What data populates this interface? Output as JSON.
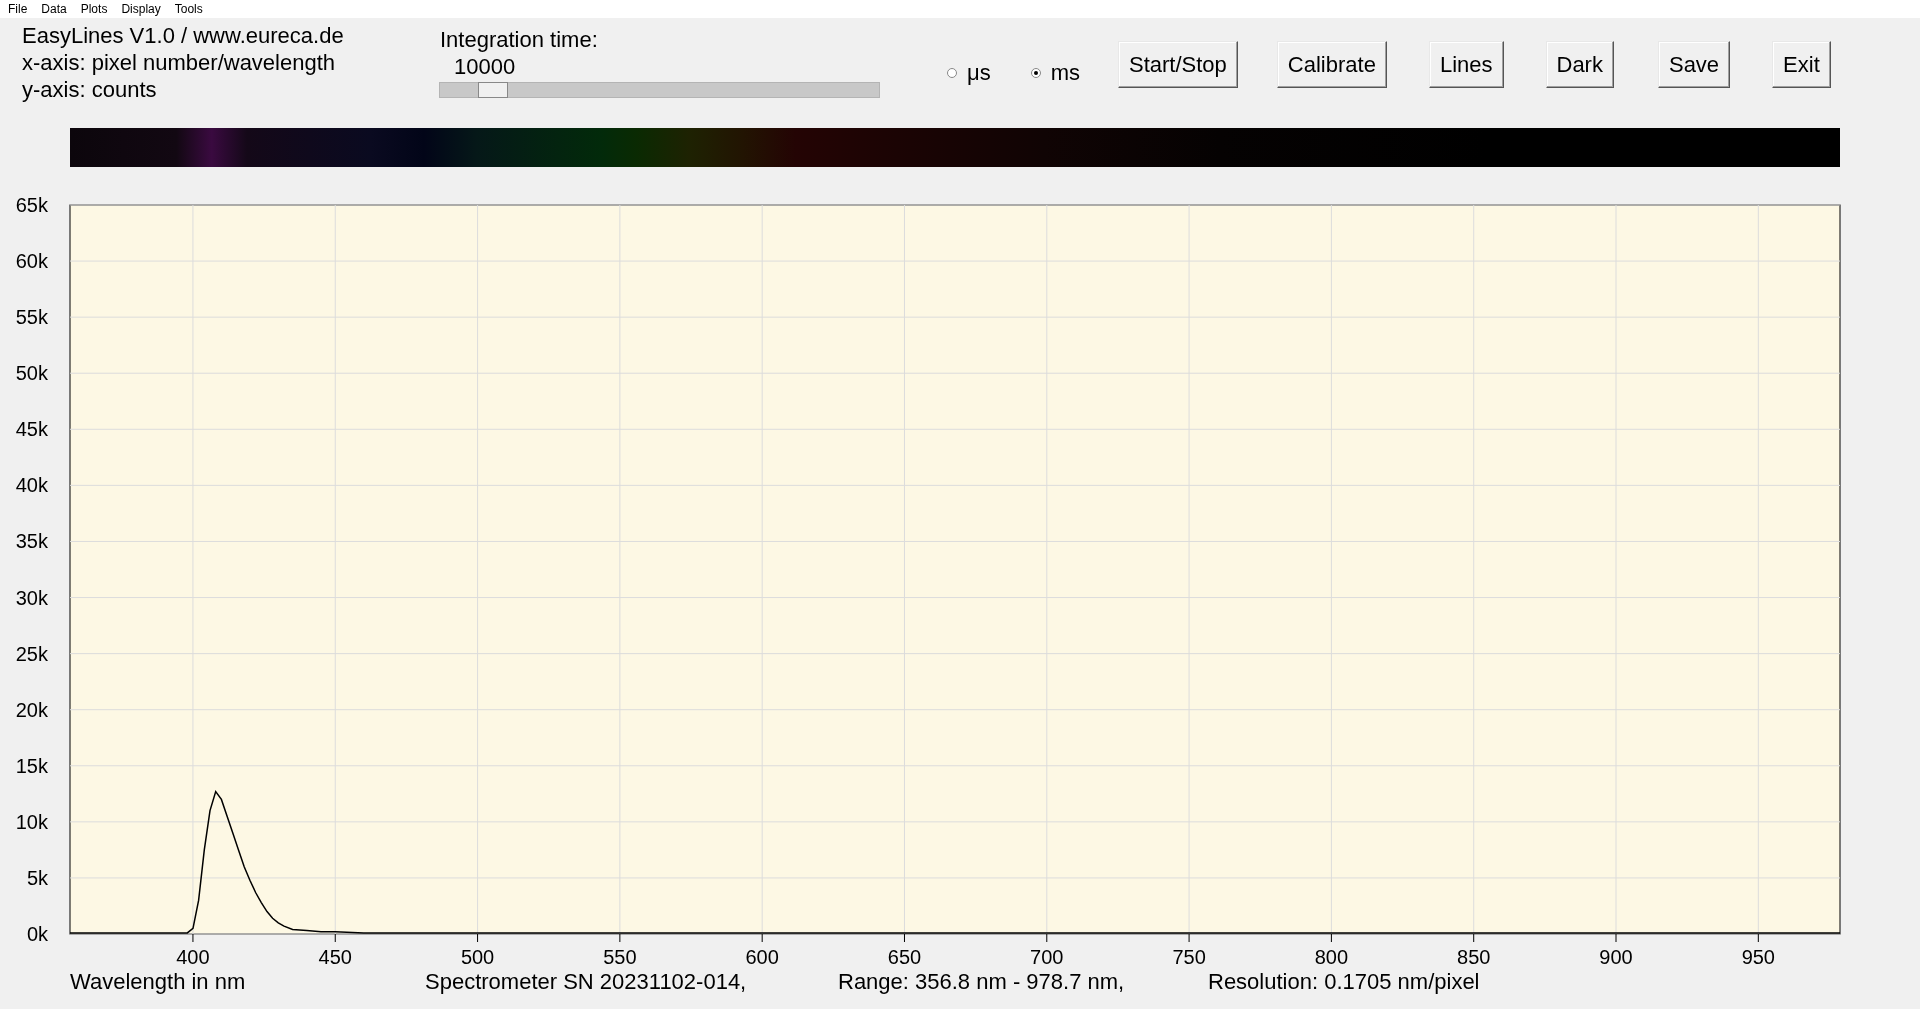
{
  "menu": [
    "File",
    "Data",
    "Plots",
    "Display",
    "Tools"
  ],
  "header": {
    "lines": [
      "EasyLines V1.0 / www.eureca.de",
      "x-axis: pixel number/wavelength",
      "y-axis: counts"
    ]
  },
  "integration": {
    "label": "Integration time:",
    "value": "10000",
    "level": 0.12
  },
  "units": [
    {
      "label": "μs",
      "selected": false
    },
    {
      "label": "ms",
      "selected": true
    }
  ],
  "buttons": [
    "Start/Stop",
    "Calibrate",
    "Lines",
    "Dark",
    "Save",
    "Exit"
  ],
  "chart": {
    "chart_data": {
      "type": "line",
      "grid": true,
      "xlabel": "Wavelength in nm",
      "xlim": [
        356.8,
        978.7
      ],
      "ylim": [
        0,
        65000
      ],
      "x": [
        356.8,
        380,
        398,
        400,
        402,
        404,
        406,
        408,
        410,
        412,
        414,
        416,
        418,
        420,
        422,
        424,
        426,
        428,
        430,
        432,
        435,
        440,
        445,
        450,
        460,
        500,
        600,
        700,
        800,
        900,
        978.7
      ],
      "series": [
        {
          "color": "#000000",
          "values": [
            100,
            100,
            100,
            500,
            3000,
            7500,
            11000,
            12700,
            12000,
            10500,
            9000,
            7500,
            6000,
            4800,
            3700,
            2800,
            2000,
            1400,
            1000,
            700,
            400,
            300,
            200,
            200,
            100,
            100,
            100,
            100,
            100,
            100,
            100
          ]
        }
      ],
      "xticks": [
        400,
        450,
        500,
        550,
        600,
        650,
        700,
        750,
        800,
        850,
        900,
        950
      ],
      "yticks": [
        {
          "value": 0,
          "label": "0k"
        },
        {
          "value": 5000,
          "label": "5k"
        },
        {
          "value": 10000,
          "label": "10k"
        },
        {
          "value": 15000,
          "label": "15k"
        },
        {
          "value": 20000,
          "label": "20k"
        },
        {
          "value": 25000,
          "label": "25k"
        },
        {
          "value": 30000,
          "label": "30k"
        },
        {
          "value": 35000,
          "label": "35k"
        },
        {
          "value": 40000,
          "label": "40k"
        },
        {
          "value": 45000,
          "label": "45k"
        },
        {
          "value": 50000,
          "label": "50k"
        },
        {
          "value": 55000,
          "label": "55k"
        },
        {
          "value": 60000,
          "label": "60k"
        },
        {
          "value": 65000,
          "label": "65k"
        }
      ]
    }
  },
  "status": [
    "Spectrometer SN 20231102-014,",
    "Range: 356.8 nm - 978.7 nm,",
    "Resolution: 0.1705 nm/pixel"
  ]
}
